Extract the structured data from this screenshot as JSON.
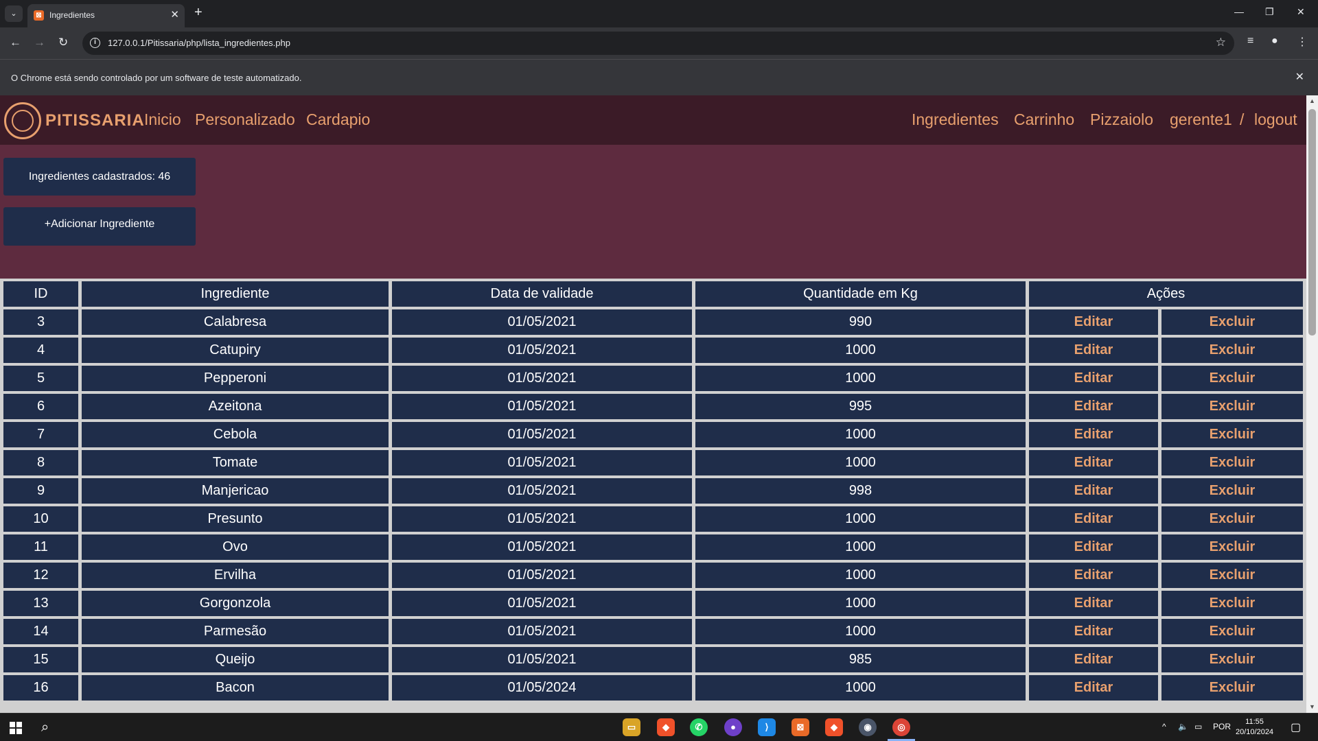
{
  "browser": {
    "tab_title": "Ingredientes",
    "url": "127.0.0.1/Pitissaria/php/lista_ingredientes.php",
    "infobar_text": "O Chrome está sendo controlado por um software de teste automatizado."
  },
  "site": {
    "logo_text": "PITISSARIA",
    "nav_left": [
      "Inicio",
      "Personalizado",
      "Cardapio"
    ],
    "nav_right": [
      "Ingredientes",
      "Carrinho",
      "Pizzaiolo",
      "gerente1"
    ],
    "nav_separator": "/",
    "logout": "logout",
    "brand_color": "#e8a06e"
  },
  "summary": {
    "count_label": "Ingredientes cadastrados: 46",
    "add_button": "+Adicionar Ingrediente"
  },
  "table": {
    "headers": [
      "ID",
      "Ingrediente",
      "Data de validade",
      "Quantidade em Kg",
      "Ações"
    ],
    "edit_label": "Editar",
    "delete_label": "Excluir",
    "rows": [
      {
        "id": "3",
        "name": "Calabresa",
        "date": "01/05/2021",
        "qty": "990"
      },
      {
        "id": "4",
        "name": "Catupiry",
        "date": "01/05/2021",
        "qty": "1000"
      },
      {
        "id": "5",
        "name": "Pepperoni",
        "date": "01/05/2021",
        "qty": "1000"
      },
      {
        "id": "6",
        "name": "Azeitona",
        "date": "01/05/2021",
        "qty": "995"
      },
      {
        "id": "7",
        "name": "Cebola",
        "date": "01/05/2021",
        "qty": "1000"
      },
      {
        "id": "8",
        "name": "Tomate",
        "date": "01/05/2021",
        "qty": "1000"
      },
      {
        "id": "9",
        "name": "Manjericao",
        "date": "01/05/2021",
        "qty": "998"
      },
      {
        "id": "10",
        "name": "Presunto",
        "date": "01/05/2021",
        "qty": "1000"
      },
      {
        "id": "11",
        "name": "Ovo",
        "date": "01/05/2021",
        "qty": "1000"
      },
      {
        "id": "12",
        "name": "Ervilha",
        "date": "01/05/2021",
        "qty": "1000"
      },
      {
        "id": "13",
        "name": "Gorgonzola",
        "date": "01/05/2021",
        "qty": "1000"
      },
      {
        "id": "14",
        "name": "Parmesão",
        "date": "01/05/2021",
        "qty": "1000"
      },
      {
        "id": "15",
        "name": "Queijo",
        "date": "01/05/2021",
        "qty": "985"
      },
      {
        "id": "16",
        "name": "Bacon",
        "date": "01/05/2024",
        "qty": "1000"
      }
    ]
  },
  "taskbar": {
    "language": "POR",
    "time": "11:55",
    "date": "20/10/2024",
    "apps": [
      "file-explorer-icon",
      "brave-icon",
      "whatsapp-icon",
      "github-desktop-icon",
      "vscode-icon",
      "xampp-icon",
      "brave-icon",
      "steam-icon",
      "chrome-icon"
    ]
  }
}
